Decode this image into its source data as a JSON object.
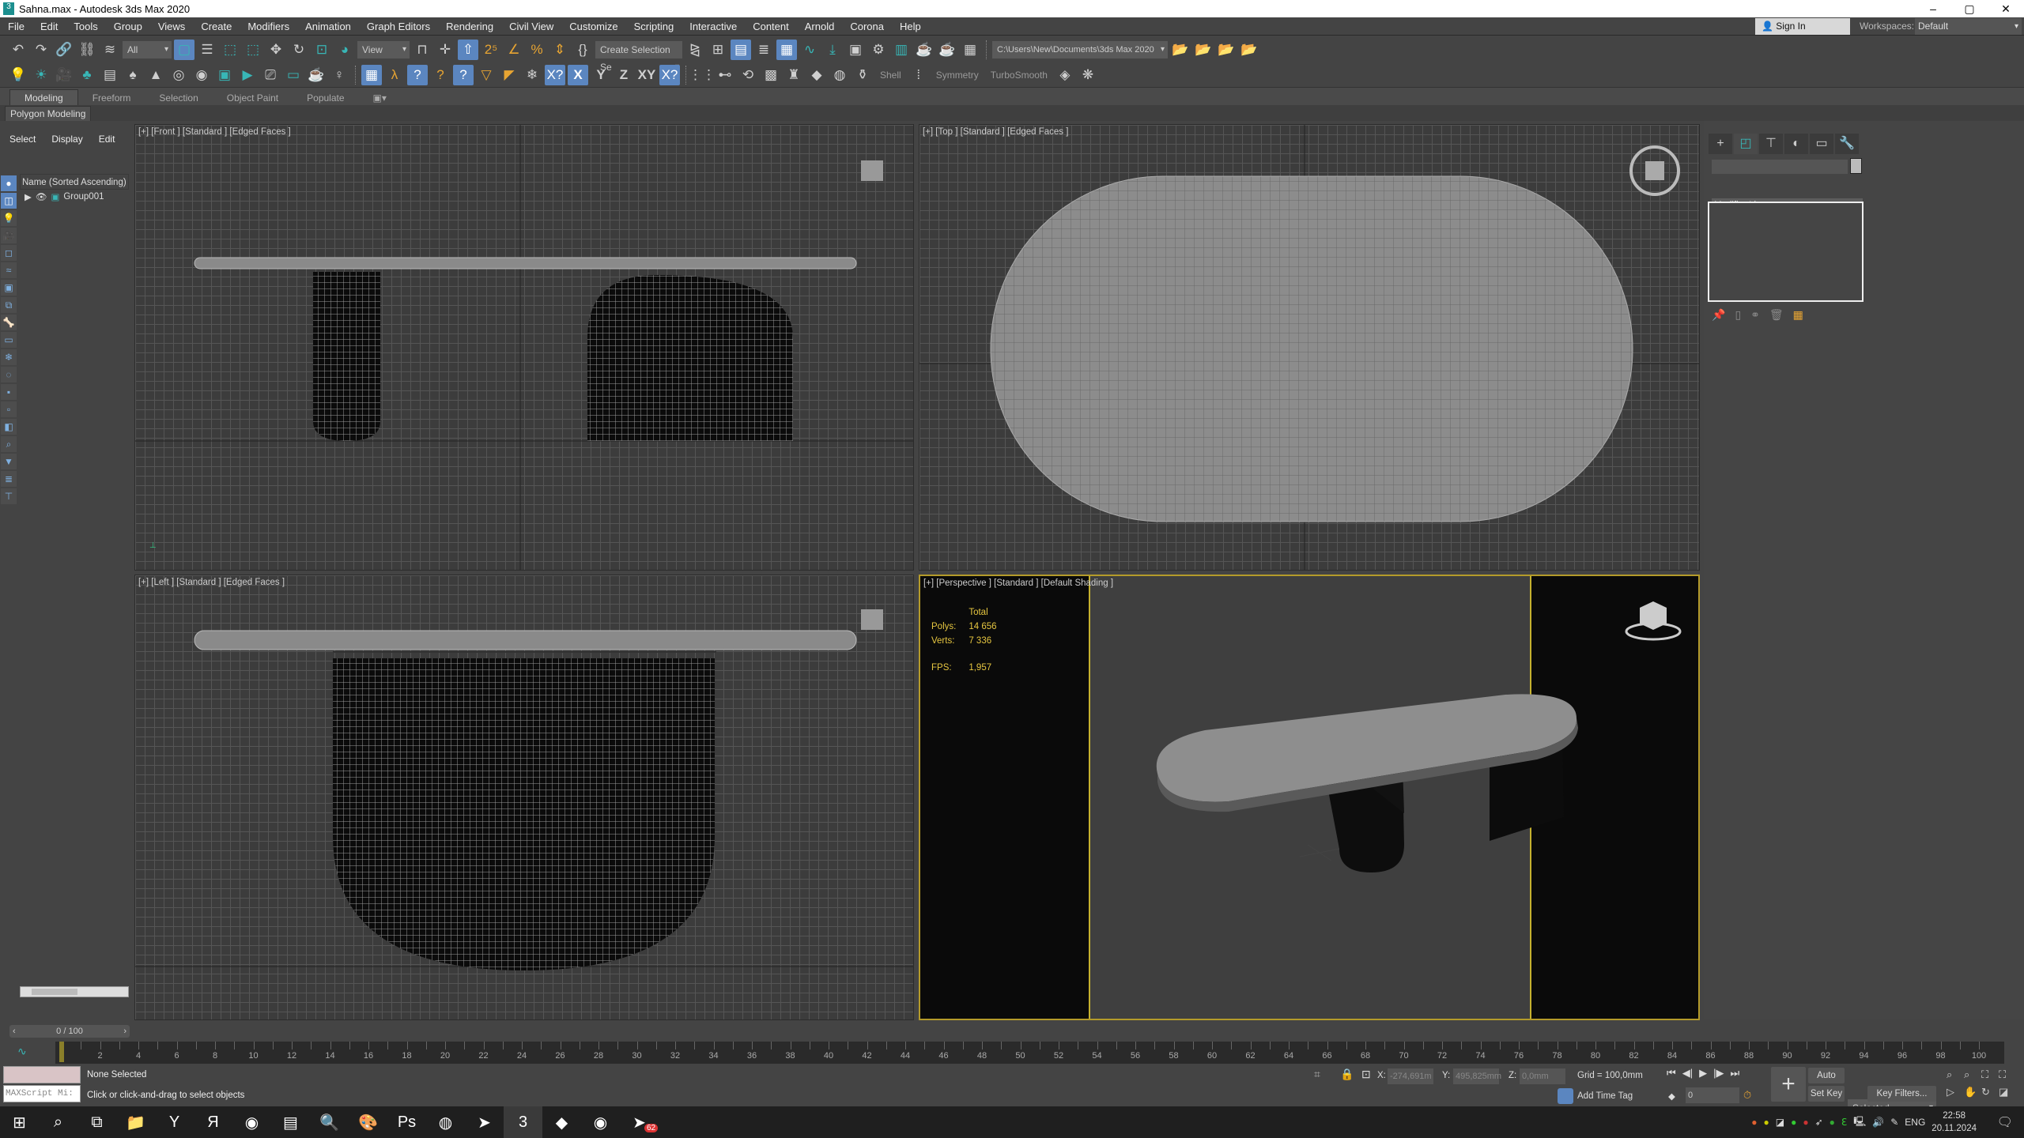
{
  "window": {
    "title": "Sahna.max - Autodesk 3ds Max 2020",
    "controls": [
      "–",
      "▢",
      "✕"
    ]
  },
  "menu": [
    "File",
    "Edit",
    "Tools",
    "Group",
    "Views",
    "Create",
    "Modifiers",
    "Animation",
    "Graph Editors",
    "Rendering",
    "Civil View",
    "Customize",
    "Scripting",
    "Interactive",
    "Content",
    "Arnold",
    "Corona",
    "Help"
  ],
  "account": {
    "sign_in": "Sign In",
    "workspaces_label": "Workspaces:",
    "workspace": "Default"
  },
  "toolbar1": {
    "selection_filter": "All",
    "ref_coord": "View",
    "named_selection": "Create Selection Se",
    "project_path": "C:\\Users\\New\\Documents\\3ds Max 2020",
    "icons_a": [
      "undo-icon",
      "redo-icon",
      "link-icon",
      "unlink-icon",
      "bind-space-warp-icon"
    ],
    "icons_b": [
      "select-object-icon",
      "select-by-name-icon",
      "rect-selection-icon",
      "window-crossing-icon",
      "move-icon",
      "rotate-icon",
      "scale-icon",
      "placement-icon"
    ],
    "icons_c": [
      "pivot-icon",
      "snap-move-icon",
      "select-manipulate-icon",
      "snap-2-5-icon",
      "angle-snap-icon",
      "percent-snap-icon",
      "spinner-snap-icon",
      "edit-named-selection-icon"
    ],
    "icons_d": [
      "mirror-icon",
      "align-icon",
      "scene-explorer-icon",
      "layer-explorer-icon",
      "ribbon-toggle-icon",
      "curve-editor-icon",
      "dope-sheet-icon",
      "material-editor-icon",
      "render-setup-icon",
      "rendered-frame-icon",
      "render-icon",
      "render-iterative-icon",
      "render-grid-icon"
    ],
    "icons_e": [
      "project-folder-icon",
      "open-folder-icon",
      "scene-tree-icon",
      "folder-tree-icon"
    ]
  },
  "toolbar2": {
    "icons": [
      "light-icon",
      "sun-icon",
      "camera-icon",
      "tree-icon",
      "list-icon",
      "foliage-icon",
      "cone-icon",
      "torus-icon",
      "sphere-icon",
      "frame-icon",
      "render-frame-icon",
      "camera-add-icon",
      "window-icon",
      "teapot-icon",
      "bulb-icon",
      "grid-snap-icon",
      "vertex-snap-icon",
      "edge-snap-icon",
      "face-snap-icon",
      "midpoint-snap-icon",
      "polygon-snap-icon",
      "triangle-snap-icon",
      "snowflake-icon",
      "xy-constraint-icon",
      "x-axis-icon",
      "y-axis-icon",
      "z-axis-icon",
      "xy-plane-icon",
      "xy-lock-icon",
      "array-icon",
      "measure-icon",
      "spacing-icon",
      "checker-icon",
      "chess-icon",
      "diamond-icon",
      "sphere-cage-icon",
      "lathe-icon"
    ],
    "axis_labels": {
      "x-axis-icon": "X",
      "y-axis-icon": "Y",
      "z-axis-icon": "Z",
      "xy-plane-icon": "XY"
    },
    "shell": "Shell",
    "symmetry": "Symmetry",
    "turbosmooth": "TurboSmooth"
  },
  "ribbon": {
    "tabs": [
      "Modeling",
      "Freeform",
      "Selection",
      "Object Paint",
      "Populate"
    ],
    "active": 0,
    "panel": "Polygon Modeling"
  },
  "scene_explorer": {
    "tabs": [
      "Select",
      "Display",
      "Edit"
    ],
    "column_header": "Name (Sorted Ascending)",
    "items": [
      {
        "name": "Group001"
      }
    ]
  },
  "viewports": {
    "front": "[+] [Front ] [Standard ] [Edged Faces ]",
    "top": "[+] [Top ] [Standard ] [Edged Faces ]",
    "left": "[+] [Left ] [Standard ] [Edged Faces ]",
    "perspective": "[+] [Perspective ] [Standard ] [Default Shading ]"
  },
  "stats": {
    "header": "Total",
    "polys_label": "Polys:",
    "polys": "14 656",
    "verts_label": "Verts:",
    "verts": "7 336",
    "fps_label": "FPS:",
    "fps": "1,957"
  },
  "command_panel": {
    "tabs": [
      "create-icon",
      "modify-icon",
      "hierarchy-icon",
      "motion-icon",
      "display-icon",
      "utilities-icon"
    ],
    "tab_glyphs": [
      "+",
      "◰",
      "⊤",
      "◐",
      "▭",
      "🔧"
    ],
    "active_tab": 1,
    "name_value": "",
    "modifier_list": "Modifier List"
  },
  "timeline": {
    "slider": "0 / 100",
    "current_frame": 0,
    "start": 0,
    "end": 100
  },
  "status": {
    "selection": "None Selected",
    "prompt": "Click or click-and-drag to select objects",
    "maxscript": "MAXScript Mi:",
    "x_label": "X:",
    "x": "-274,691m",
    "y_label": "Y:",
    "y": "495,825mm",
    "z_label": "Z:",
    "z": "0,0mm",
    "grid": "Grid = 100,0mm",
    "add_time_tag": "Add Time Tag",
    "frame_value": "0",
    "auto_key": "Auto Key",
    "set_key": "Set Key",
    "key_mode": "Selected",
    "key_filters": "Key Filters..."
  },
  "taskbar": {
    "apps": [
      "start-icon",
      "search-icon",
      "task-view-icon",
      "file-explorer-icon",
      "yandex-browser-icon",
      "yandex-icon",
      "chrome-icon",
      "winrar-icon",
      "magnifier-icon",
      "paint-icon",
      "photoshop-icon",
      "recorder-icon",
      "telegram-icon",
      "3dsmax-icon",
      "blender-market-icon",
      "chrome-icon-2",
      "telegram-badge-icon"
    ],
    "glyphs": [
      "⊞",
      "⌕",
      "⧉",
      "📁",
      "Y",
      "Я",
      "◉",
      "▤",
      "🔍",
      "🎨",
      "Ps",
      "◍",
      "➤",
      "3",
      "◆",
      "◉",
      "➤"
    ],
    "active": 13,
    "badge": "62",
    "lang": "ENG",
    "time": "22:58",
    "date": "20.11.2024"
  }
}
